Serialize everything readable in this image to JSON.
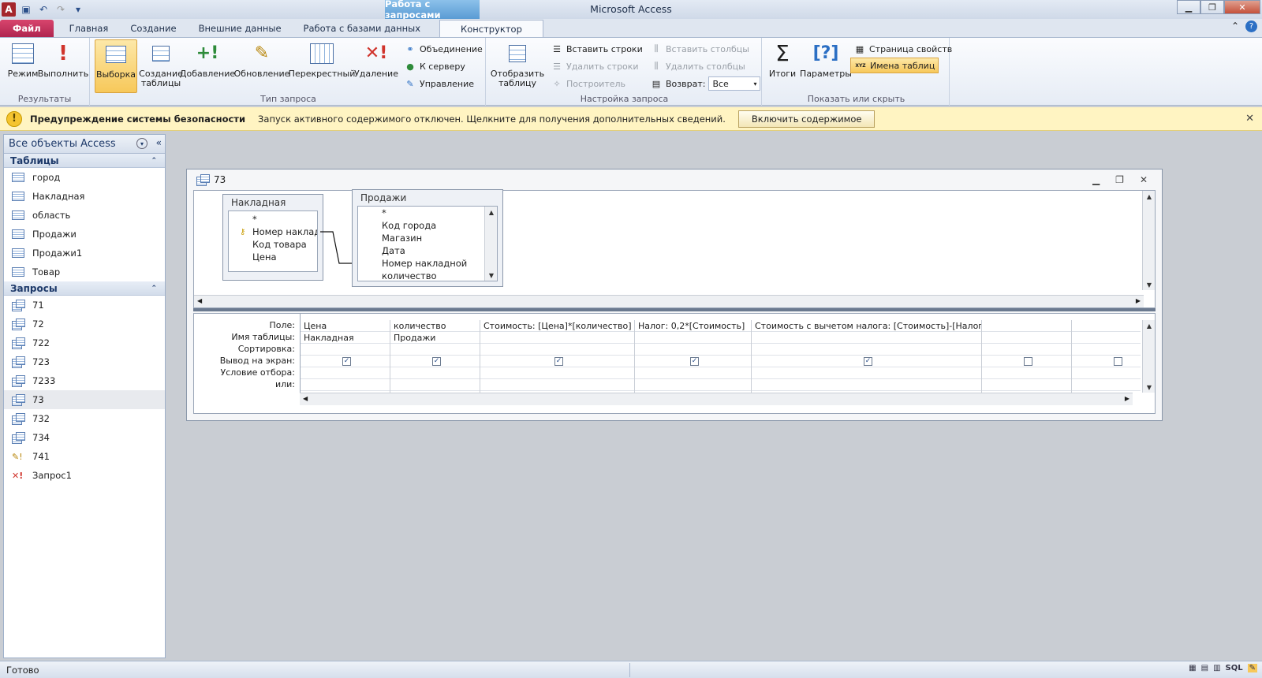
{
  "app": {
    "title": "Microsoft Access",
    "logo_letter": "A",
    "context_group": "Работа с запросами"
  },
  "tabs": [
    "Файл",
    "Главная",
    "Создание",
    "Внешние данные",
    "Работа с базами данных",
    "Конструктор"
  ],
  "ribbon": {
    "groups": {
      "results": "Результаты",
      "query_type": "Тип запроса",
      "query_setup": "Настройка запроса",
      "show_hide": "Показать или скрыть"
    },
    "mode": "Режим",
    "run": "Выполнить",
    "select": "Выборка",
    "make_table": "Создание таблицы",
    "append": "Добавление",
    "update": "Обновление",
    "crosstab": "Перекрестный",
    "delete": "Удаление",
    "union": "Объединение",
    "to_server": "К серверу",
    "manage": "Управление",
    "show_table": "Отобразить таблицу",
    "insert_rows": "Вставить строки",
    "delete_rows": "Удалить строки",
    "builder": "Построитель",
    "insert_cols": "Вставить столбцы",
    "delete_cols": "Удалить столбцы",
    "return_label": "Возврат:",
    "return_value": "Все",
    "totals": "Итоги",
    "parameters": "Параметры",
    "property_sheet": "Страница свойств",
    "table_names": "Имена таблиц",
    "table_names_badge": "XYZ"
  },
  "security": {
    "title": "Предупреждение системы безопасности",
    "message": "Запуск активного содержимого отключен. Щелкните для получения дополнительных сведений.",
    "button": "Включить содержимое",
    "icon": "!"
  },
  "nav": {
    "header": "Все объекты Access",
    "tables_label": "Таблицы",
    "tables": [
      "город",
      "Накладная",
      "область",
      "Продажи",
      "Продажи1",
      "Товар"
    ],
    "queries_label": "Запросы",
    "queries": [
      "71",
      "72",
      "722",
      "723",
      "7233",
      "73",
      "732",
      "734",
      "741",
      "Запрос1"
    ],
    "selected_query": "73"
  },
  "query_window": {
    "title": "73",
    "table1": {
      "name": "Накладная",
      "fields": [
        "*",
        "Номер накладн",
        "Код товара",
        "Цена"
      ]
    },
    "table2": {
      "name": "Продажи",
      "fields": [
        "*",
        "Код города",
        "Магазин",
        "Дата",
        "Номер накладной",
        "количество"
      ]
    },
    "grid": {
      "row_labels": [
        "Поле:",
        "Имя таблицы:",
        "Сортировка:",
        "Вывод на экран:",
        "Условие отбора:",
        "или:"
      ],
      "columns": [
        {
          "field": "Цена",
          "table": "Накладная",
          "show": true
        },
        {
          "field": "количество",
          "table": "Продажи",
          "show": true
        },
        {
          "field": "Стоимость: [Цена]*[количество]",
          "table": "",
          "show": true
        },
        {
          "field": "Налог: 0,2*[Стоимость]",
          "table": "",
          "show": true
        },
        {
          "field": "Стоимость с вычетом налога: [Стоимость]-[Налог]",
          "table": "",
          "show": true
        },
        {
          "field": "",
          "table": "",
          "show": false
        },
        {
          "field": "",
          "table": "",
          "show": false
        }
      ]
    }
  },
  "status": {
    "text": "Готово",
    "sql_label": "SQL"
  },
  "colors": {
    "file_tab": "#b02650",
    "context_tab": "#5a9bd4",
    "security_bar": "#fff4c2",
    "selected_button": "#f7c85a"
  }
}
